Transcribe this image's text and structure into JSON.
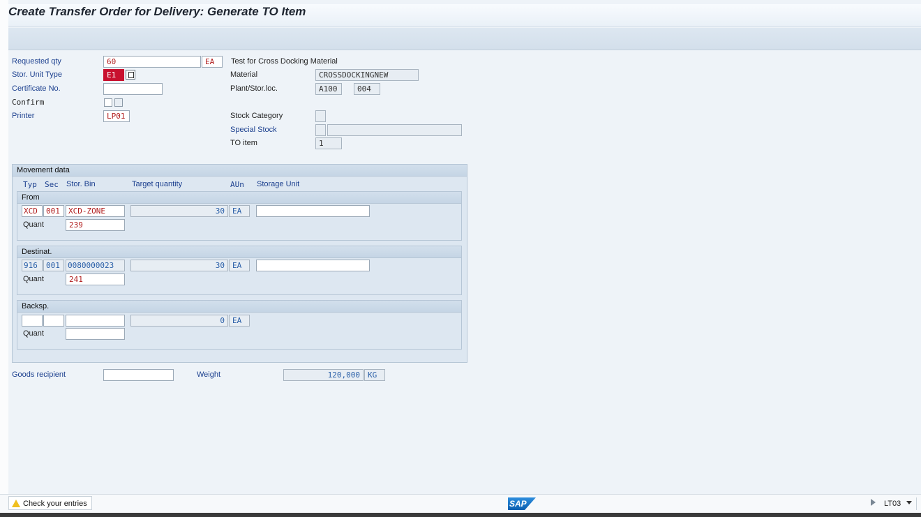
{
  "window": {
    "title": "Create Transfer Order for Delivery: Generate TO Item"
  },
  "header": {
    "requested_qty": {
      "label": "Requested qty",
      "value": "60",
      "unit": "EA"
    },
    "description": "Test  for Cross Docking Material",
    "stor_unit_type": {
      "label": "Stor. Unit Type",
      "value": "E1"
    },
    "certificate_no": {
      "label": "Certificate No.",
      "value": ""
    },
    "confirm": {
      "label": "Confirm"
    },
    "printer": {
      "label": "Printer",
      "value": "LP01"
    },
    "material": {
      "label": "Material",
      "value": "CROSSDOCKINGNEW"
    },
    "plant_stor_loc": {
      "label": "Plant/Stor.loc.",
      "plant": "A100",
      "sloc": "004"
    },
    "stock_category": {
      "label": "Stock Category",
      "value": ""
    },
    "special_stock": {
      "label": "Special Stock",
      "value": "",
      "value2": ""
    },
    "to_item": {
      "label": "TO item",
      "value": "1"
    }
  },
  "movement": {
    "title": "Movement data",
    "columns": {
      "typ": "Typ",
      "sec": "Sec",
      "bin": "Stor. Bin",
      "target_qty": "Target quantity",
      "aun": "AUn",
      "storage_unit": "Storage Unit"
    },
    "from": {
      "title": "From",
      "typ": "XCD",
      "sec": "001",
      "bin": "XCD-ZONE",
      "qty": "30",
      "aun": "EA",
      "storage_unit": "",
      "quant_label": "Quant",
      "quant": "239"
    },
    "dest": {
      "title": "Destinat.",
      "typ": "916",
      "sec": "001",
      "bin": "0080000023",
      "qty": "30",
      "aun": "EA",
      "storage_unit": "",
      "quant_label": "Quant",
      "quant": "241"
    },
    "backsp": {
      "title": "Backsp.",
      "typ": "",
      "sec": "",
      "bin": "",
      "qty": "0",
      "aun": "EA",
      "quant_label": "Quant",
      "quant": ""
    }
  },
  "footer": {
    "goods_recipient": {
      "label": "Goods recipient",
      "value": ""
    },
    "weight": {
      "label": "Weight",
      "value": "120,000",
      "unit": "KG"
    }
  },
  "status": {
    "message": "Check your entries",
    "transaction": "LT03",
    "logo": "SAP",
    "warning_icon": "warning-icon",
    "colors": {
      "error": "#c8102e",
      "label_blue": "#1b3f8e",
      "value_red": "#b01c1c"
    }
  }
}
